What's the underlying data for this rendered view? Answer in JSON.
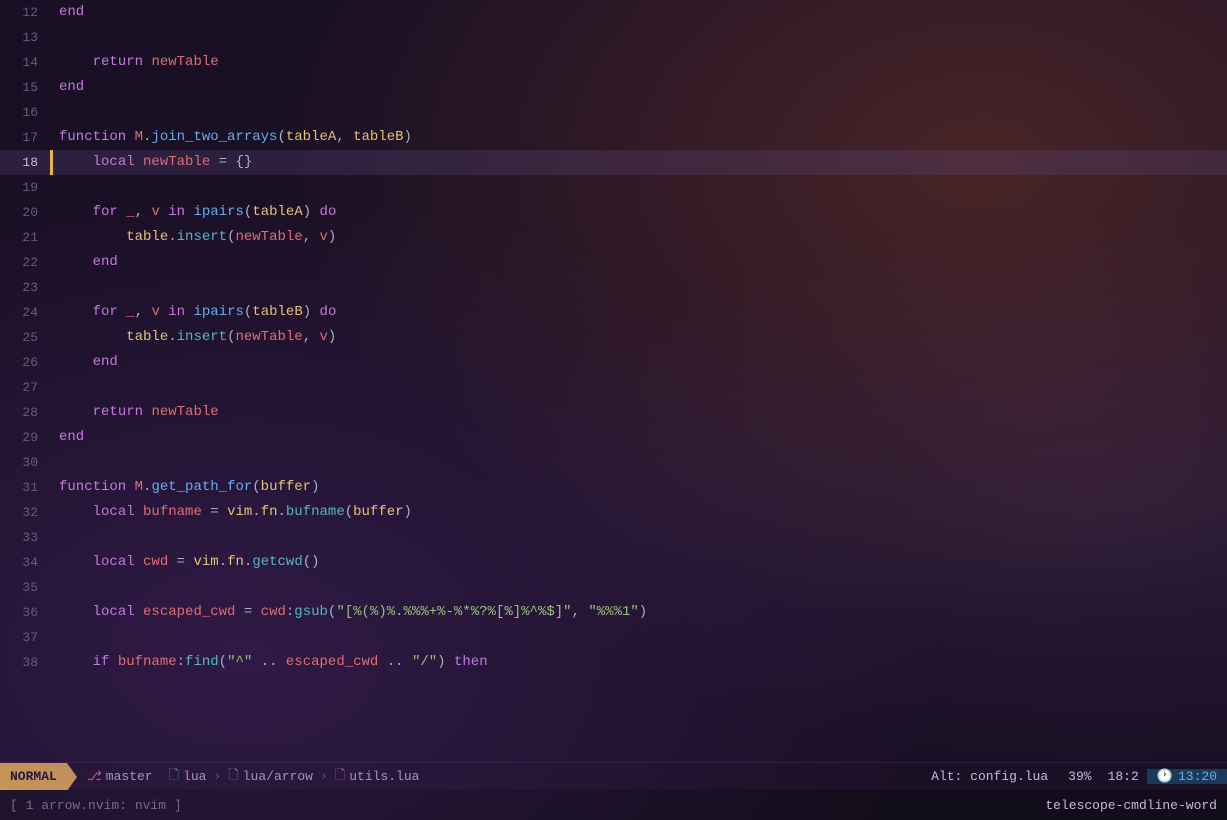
{
  "editor": {
    "title": "lua/arrow/utils.lua",
    "mode": "NORMAL",
    "branch": "master",
    "file_path": {
      "part1": "lua",
      "part2": "lua/arrow",
      "part3": "utils.lua"
    },
    "alt_file": "Alt: config.lua",
    "scroll_pct": "39%",
    "cursor_pos": "18:2",
    "time": "13:20"
  },
  "bottom": {
    "left": "[ 1 arrow.nvim: nvim ]",
    "right": "telescope-cmdline-word"
  },
  "lines": [
    {
      "num": "12",
      "content": "end",
      "current": false
    },
    {
      "num": "13",
      "content": "",
      "current": false
    },
    {
      "num": "14",
      "content": "    return newTable",
      "current": false
    },
    {
      "num": "15",
      "content": "end",
      "current": false
    },
    {
      "num": "16",
      "content": "",
      "current": false
    },
    {
      "num": "17",
      "content": "function M.join_two_arrays(tableA, tableB)",
      "current": false
    },
    {
      "num": "18",
      "content": "    local newTable = {}",
      "current": true
    },
    {
      "num": "19",
      "content": "",
      "current": false
    },
    {
      "num": "20",
      "content": "    for _, v in ipairs(tableA) do",
      "current": false
    },
    {
      "num": "21",
      "content": "        table.insert(newTable, v)",
      "current": false
    },
    {
      "num": "22",
      "content": "    end",
      "current": false
    },
    {
      "num": "23",
      "content": "",
      "current": false
    },
    {
      "num": "24",
      "content": "    for _, v in ipairs(tableB) do",
      "current": false
    },
    {
      "num": "25",
      "content": "        table.insert(newTable, v)",
      "current": false
    },
    {
      "num": "26",
      "content": "    end",
      "current": false
    },
    {
      "num": "27",
      "content": "",
      "current": false
    },
    {
      "num": "28",
      "content": "    return newTable",
      "current": false
    },
    {
      "num": "29",
      "content": "end",
      "current": false
    },
    {
      "num": "30",
      "content": "",
      "current": false
    },
    {
      "num": "31",
      "content": "function M.get_path_for(buffer)",
      "current": false
    },
    {
      "num": "32",
      "content": "    local bufname = vim.fn.bufname(buffer)",
      "current": false
    },
    {
      "num": "33",
      "content": "",
      "current": false
    },
    {
      "num": "34",
      "content": "    local cwd = vim.fn.getcwd()",
      "current": false
    },
    {
      "num": "35",
      "content": "",
      "current": false
    },
    {
      "num": "36",
      "content": "    local escaped_cwd = cwd:gsub(\"[%(%)%.%%%+%-%*%?%[%]%^%$]\", \"%%%1\")",
      "current": false
    },
    {
      "num": "37",
      "content": "",
      "current": false
    },
    {
      "num": "38",
      "content": "    if bufname:find(\"^\" .. escaped_cwd .. \"/\") then",
      "current": false
    }
  ]
}
